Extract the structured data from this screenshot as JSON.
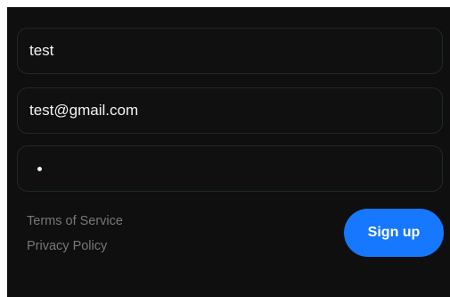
{
  "form": {
    "name_value": "test",
    "email_value": "test@gmail.com",
    "password_mask": "•"
  },
  "links": {
    "terms": "Terms of Service",
    "privacy": "Privacy Policy"
  },
  "actions": {
    "signup_label": "Sign up"
  },
  "colors": {
    "background": "#0f0f0f",
    "button": "#1677ff"
  }
}
